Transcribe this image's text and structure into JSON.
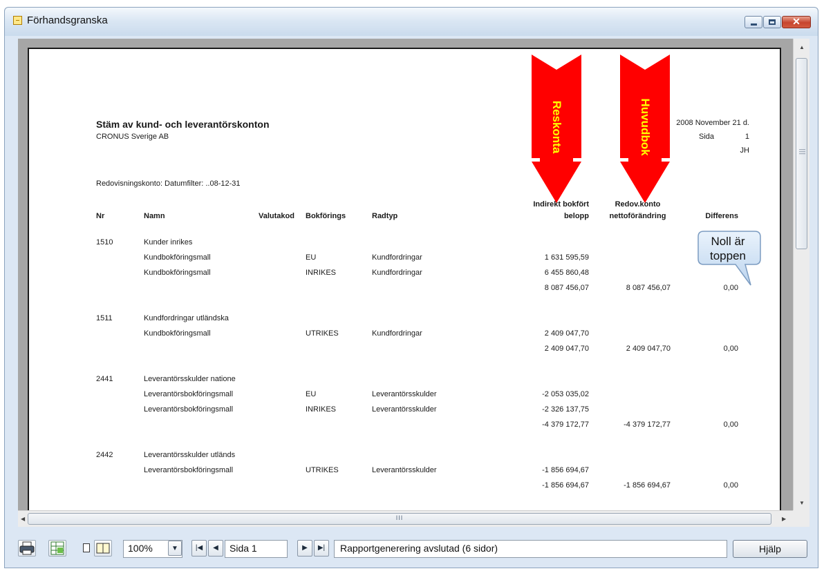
{
  "window": {
    "title": "Förhandsgranska"
  },
  "report": {
    "title": "Stäm av kund- och leverantörskonton",
    "company": "CRONUS Sverige AB",
    "date": "2008 November 21 d.",
    "page_label": "Sida",
    "page_number": "1",
    "user": "JH",
    "filter": "Redovisningskonto: Datumfilter: ..08-12-31",
    "headers": {
      "nr": "Nr",
      "namn": "Namn",
      "valutakod": "Valutakod",
      "bokforings": "Bokförings",
      "radtyp": "Radtyp",
      "indirekt_1": "Indirekt bokfört",
      "indirekt_2": "belopp",
      "redov_1": "Redov.konto",
      "redov_2": "nettoförändring",
      "differens": "Differens"
    },
    "rows": [
      {
        "nr": "1510",
        "namn": "Kunder inrikes",
        "bokforings": "",
        "radtyp": "",
        "belopp": "",
        "netto": "",
        "diff": ""
      },
      {
        "nr": "",
        "namn": "Kundbokföringsmall",
        "bokforings": "EU",
        "radtyp": "Kundfordringar",
        "belopp": "1 631 595,59",
        "netto": "",
        "diff": ""
      },
      {
        "nr": "",
        "namn": "Kundbokföringsmall",
        "bokforings": "INRIKES",
        "radtyp": "Kundfordringar",
        "belopp": "6 455 860,48",
        "netto": "",
        "diff": ""
      },
      {
        "nr": "",
        "namn": "",
        "bokforings": "",
        "radtyp": "",
        "belopp": "8 087 456,07",
        "netto": "8 087 456,07",
        "diff": "0,00"
      },
      {
        "nr": "1511",
        "namn": "Kundfordringar utländska",
        "bokforings": "",
        "radtyp": "",
        "belopp": "",
        "netto": "",
        "diff": ""
      },
      {
        "nr": "",
        "namn": "Kundbokföringsmall",
        "bokforings": "UTRIKES",
        "radtyp": "Kundfordringar",
        "belopp": "2 409 047,70",
        "netto": "",
        "diff": ""
      },
      {
        "nr": "",
        "namn": "",
        "bokforings": "",
        "radtyp": "",
        "belopp": "2 409 047,70",
        "netto": "2 409 047,70",
        "diff": "0,00"
      },
      {
        "nr": "2441",
        "namn": "Leverantörsskulder natione",
        "bokforings": "",
        "radtyp": "",
        "belopp": "",
        "netto": "",
        "diff": ""
      },
      {
        "nr": "",
        "namn": "Leverantörsbokföringsmall",
        "bokforings": "EU",
        "radtyp": "Leverantörsskulder",
        "belopp": "-2 053 035,02",
        "netto": "",
        "diff": ""
      },
      {
        "nr": "",
        "namn": "Leverantörsbokföringsmall",
        "bokforings": "INRIKES",
        "radtyp": "Leverantörsskulder",
        "belopp": "-2 326 137,75",
        "netto": "",
        "diff": ""
      },
      {
        "nr": "",
        "namn": "",
        "bokforings": "",
        "radtyp": "",
        "belopp": "-4 379 172,77",
        "netto": "-4 379 172,77",
        "diff": "0,00"
      },
      {
        "nr": "2442",
        "namn": "Leverantörsskulder utländs",
        "bokforings": "",
        "radtyp": "",
        "belopp": "",
        "netto": "",
        "diff": ""
      },
      {
        "nr": "",
        "namn": "Leverantörsbokföringsmall",
        "bokforings": "UTRIKES",
        "radtyp": "Leverantörsskulder",
        "belopp": "-1 856 694,67",
        "netto": "",
        "diff": ""
      },
      {
        "nr": "",
        "namn": "",
        "bokforings": "",
        "radtyp": "",
        "belopp": "-1 856 694,67",
        "netto": "-1 856 694,67",
        "diff": "0,00"
      }
    ]
  },
  "annotations": {
    "arrow_left": "Reskonta",
    "arrow_right": "Huvudbok",
    "callout_line1": "Noll är",
    "callout_line2": "toppen",
    "arrow_color": "#ff0000",
    "arrow_text_color": "#ffff00"
  },
  "scrollbar": {
    "grip": "III"
  },
  "toolbar": {
    "zoom": "100%",
    "page": "Sida 1",
    "status": "Rapportgenerering avslutad (6 sidor)",
    "help": "Hjälp"
  }
}
